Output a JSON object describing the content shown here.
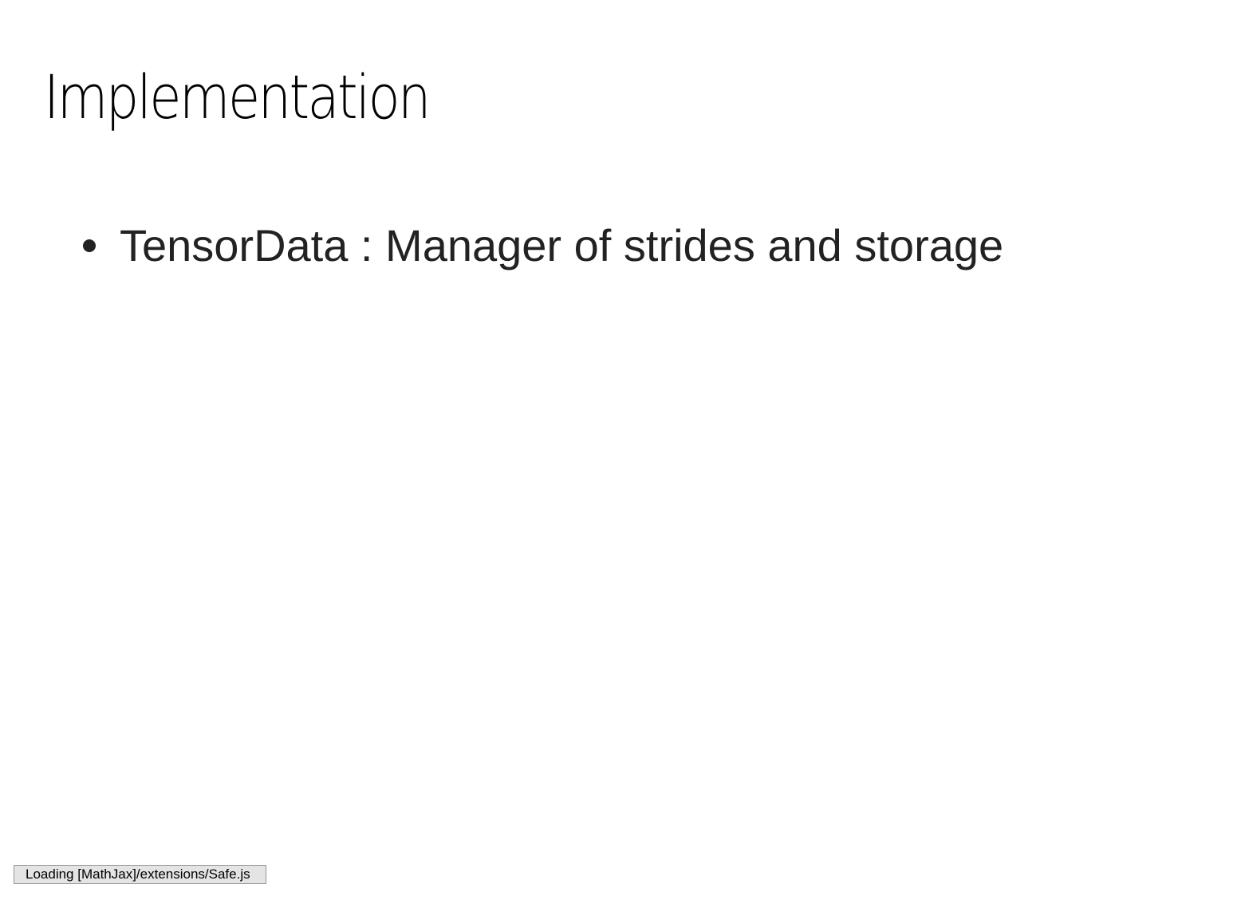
{
  "slide": {
    "title": "Implementation",
    "bullets": [
      {
        "text": "TensorData : Manager of strides and storage"
      }
    ]
  },
  "status": {
    "message": "Loading [MathJax]/extensions/Safe.js"
  },
  "colors": {
    "background": "#ffffff",
    "title": "#000000",
    "body_text": "#222222",
    "status_bg": "#e4e4e4",
    "status_border": "#959595"
  }
}
